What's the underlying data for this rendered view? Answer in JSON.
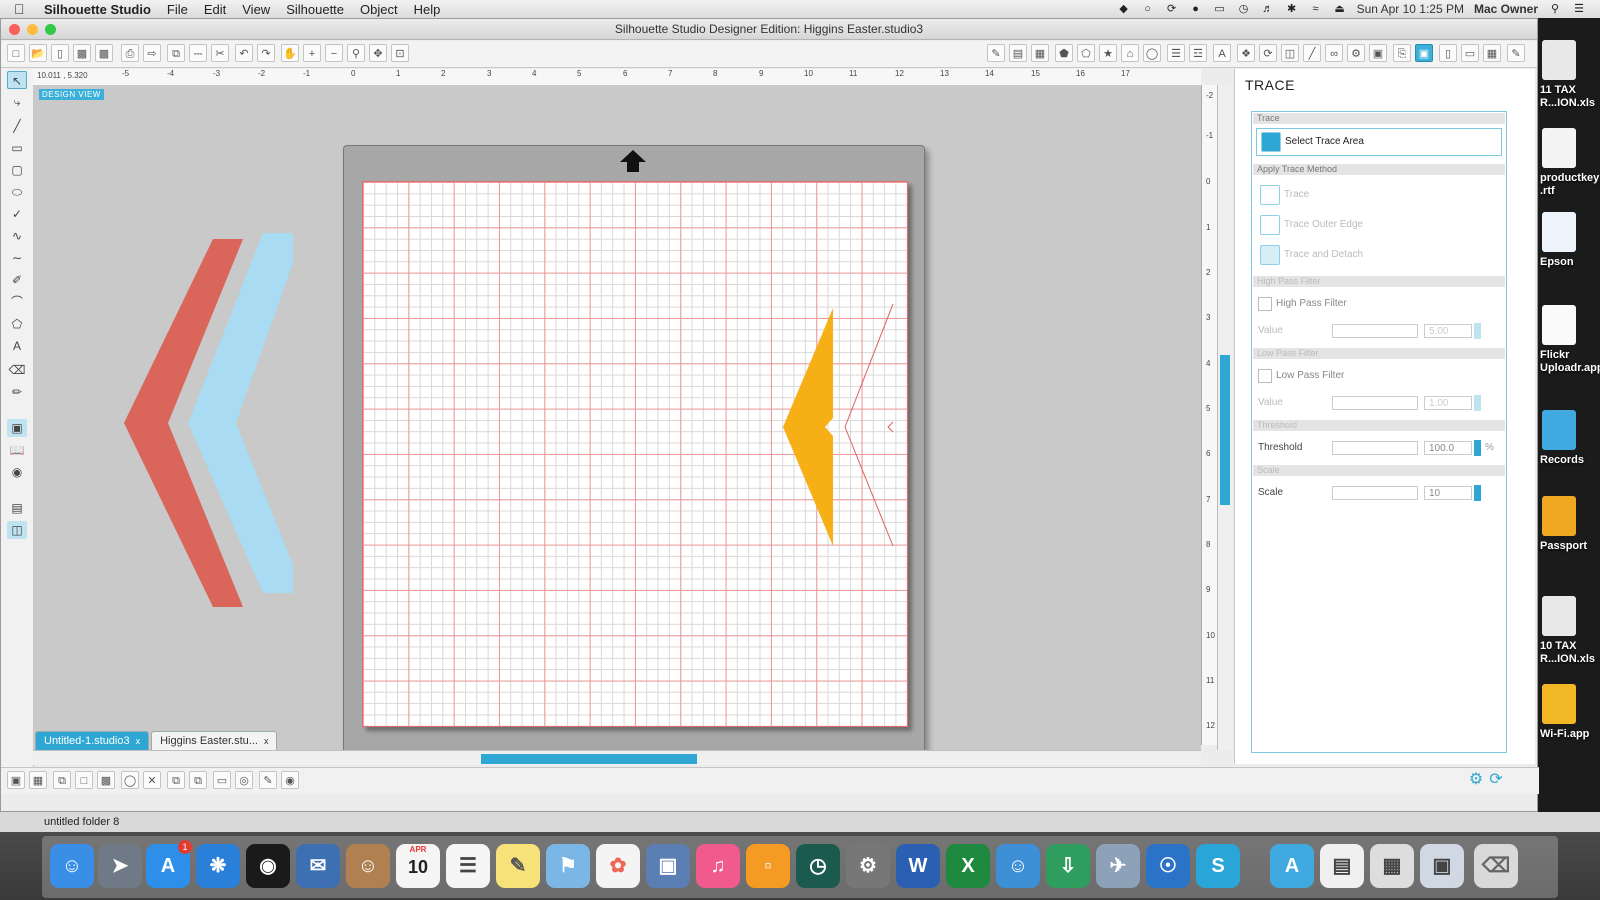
{
  "menubar": {
    "app": "Silhouette Studio",
    "items": [
      "File",
      "Edit",
      "View",
      "Silhouette",
      "Object",
      "Help"
    ],
    "clock": "Sun Apr 10  1:25 PM",
    "user": "Mac Owner"
  },
  "window": {
    "title": "Silhouette Studio Designer Edition: Higgins Easter.studio3"
  },
  "canvas": {
    "design_view_label": "DESIGN VIEW",
    "cursor_readout": "10.011 , 5.320",
    "ruler_labels": [
      "-5",
      "-4",
      "-3",
      "-2",
      "-1",
      "0",
      "1",
      "2",
      "3",
      "4",
      "5",
      "6",
      "7",
      "8",
      "9",
      "10",
      "11",
      "12",
      "13",
      "14",
      "15",
      "16",
      "17"
    ],
    "vruler_labels": [
      "-2",
      "-1",
      "0",
      "1",
      "2",
      "3",
      "4",
      "5",
      "6",
      "7",
      "8",
      "9",
      "10",
      "11",
      "12"
    ]
  },
  "tabs": [
    {
      "label": "Untitled-1.studio3",
      "close": "x",
      "active": true
    },
    {
      "label": "Higgins Easter.stu...",
      "close": "x",
      "active": false
    }
  ],
  "trace_panel": {
    "title": "TRACE",
    "section_trace": "Trace",
    "select_area": "Select Trace Area",
    "section_method": "Apply Trace Method",
    "method_trace": "Trace",
    "method_outer": "Trace Outer Edge",
    "method_detach": "Trace and Detach",
    "section_high": "High Pass Filter",
    "high_pass_label": "High Pass Filter",
    "value_label": "Value",
    "high_value": "5.00",
    "section_low": "Low Pass Filter",
    "low_pass_label": "Low Pass Filter",
    "low_value": "1.00",
    "section_threshold": "Threshold",
    "threshold_label": "Threshold",
    "threshold_value": "100.0",
    "threshold_unit": "%",
    "section_scale": "Scale",
    "scale_label": "Scale",
    "scale_value": "10"
  },
  "status": {
    "text": "untitled folder 8"
  },
  "desktop": {
    "icons": [
      "11 TAX R...ION.xls",
      "productkey .rtf",
      "Epson",
      "Flickr Uploadr.app",
      "Records",
      "Passport",
      "10 TAX R...ION.xls",
      "Wi-Fi.app"
    ]
  },
  "dock": {
    "calendar_month": "APR",
    "calendar_day": "10",
    "app_store_badge": "1"
  },
  "colors": {
    "accent": "#2ea7d4",
    "chevron_red": "#d9655b",
    "chevron_blue": "#a9dbf2",
    "chevron_orange": "#f6b016"
  }
}
